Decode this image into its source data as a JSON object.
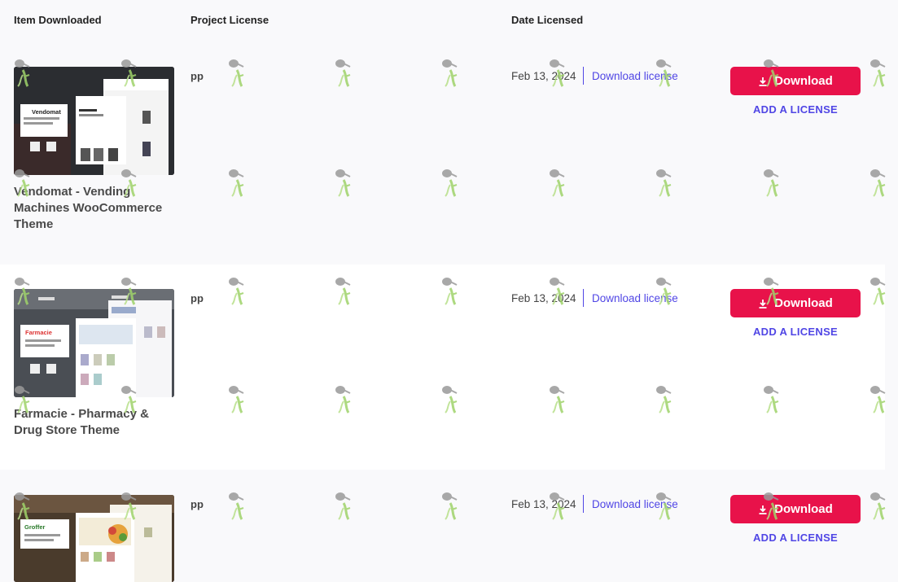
{
  "header": {
    "col_item": "Item Downloaded",
    "col_license": "Project License",
    "col_date": "Date Licensed"
  },
  "rows": [
    {
      "title": "Vendomat - Vending Machines WooCommerce Theme",
      "thumb_brand": "Vendomat",
      "thumb_tag": "Vending Machines WooCommerce Theme",
      "project_license": "pp",
      "date": "Feb 13, 2024",
      "download_license_label": "Download license",
      "download_label": "Download",
      "add_license_label": "ADD A LICENSE"
    },
    {
      "title": "Farmacie - Pharmacy & Drug Store Theme",
      "thumb_brand": "Farmacie",
      "thumb_tag": "Pharmacy & Drug Store WordPress Theme",
      "project_license": "pp",
      "date": "Feb 13, 2024",
      "download_license_label": "Download license",
      "download_label": "Download",
      "add_license_label": "ADD A LICENSE"
    },
    {
      "title": "",
      "thumb_brand": "Groffer",
      "thumb_tag": "Organic Food Store WordPress Theme",
      "project_license": "pp",
      "date": "Feb 13, 2024",
      "download_license_label": "Download license",
      "download_label": "Download",
      "add_license_label": "ADD A LICENSE"
    }
  ],
  "colors": {
    "accent_button": "#e8124a",
    "link": "#5046e5",
    "row_alt": "#ffffff",
    "row_base": "#f9f9fb"
  }
}
